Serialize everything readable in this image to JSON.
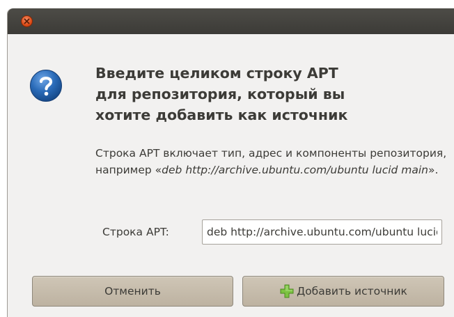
{
  "window": {
    "title": ""
  },
  "dialog": {
    "heading": "Введите целиком строку APT\nдля репозитория, который вы\nхотите добавить как источник",
    "description_prefix": "Строка APT включает тип, адрес и компоненты репозитория, например «",
    "description_example": "deb http://archive.ubuntu.com/ubuntu lucid main",
    "description_suffix": "».",
    "apt_line_label": "Строка APT:",
    "apt_line_value": "deb http://archive.ubuntu.com/ubuntu lucid main"
  },
  "buttons": {
    "cancel_label": "Отменить",
    "add_label": "Добавить источник"
  },
  "icons": {
    "close": "close-icon",
    "dialog": "question-icon",
    "add": "plus-icon"
  },
  "colors": {
    "titlebar": "#3c3b37",
    "close_button": "#df4b16",
    "question_icon": "#2a6bb8",
    "plus_icon": "#7cc242",
    "button": "#c7bdac"
  }
}
